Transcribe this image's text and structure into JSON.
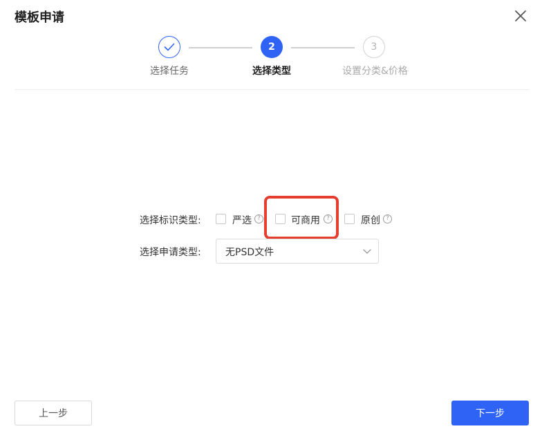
{
  "dialog": {
    "title": "模板申请"
  },
  "steps": [
    {
      "label": "选择任务",
      "state": "done"
    },
    {
      "label": "选择类型",
      "number": "2",
      "state": "active"
    },
    {
      "label": "设置分类&价格",
      "number": "3",
      "state": "pending"
    }
  ],
  "form": {
    "mark_type_label": "选择标识类型:",
    "mark_options": [
      {
        "label": "严选",
        "checked": false
      },
      {
        "label": "可商用",
        "checked": false
      },
      {
        "label": "原创",
        "checked": false
      }
    ],
    "help_glyph": "?",
    "apply_type_label": "选择申请类型:",
    "apply_type_value": "无PSD文件"
  },
  "footer": {
    "prev_label": "上一步",
    "next_label": "下一步"
  },
  "colors": {
    "primary": "#2f63f5",
    "highlight": "#e53e2f"
  }
}
